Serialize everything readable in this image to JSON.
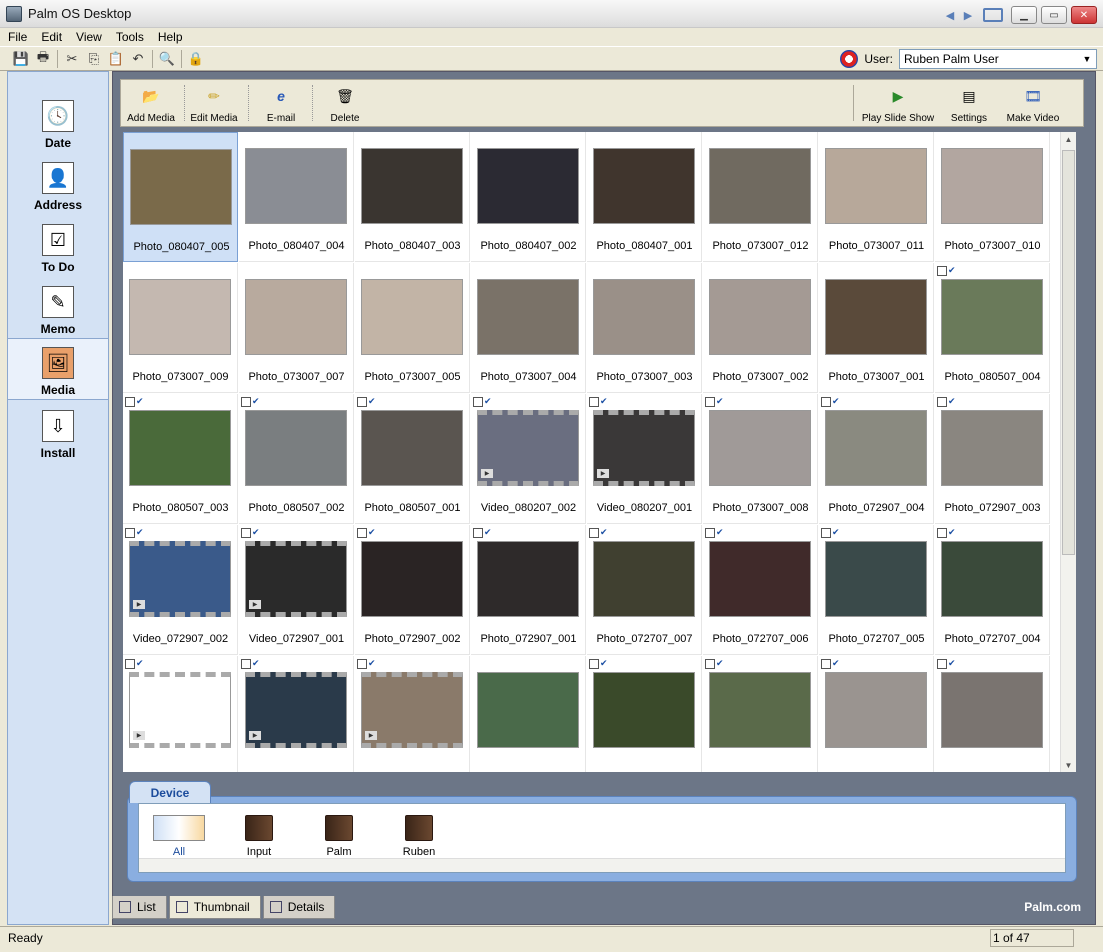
{
  "window": {
    "title": "Palm OS Desktop"
  },
  "menu": [
    "File",
    "Edit",
    "View",
    "Tools",
    "Help"
  ],
  "user": {
    "label": "User:",
    "value": "Ruben Palm User"
  },
  "sidebar": {
    "items": [
      {
        "label": "Date",
        "icon": "clock-calendar-icon"
      },
      {
        "label": "Address",
        "icon": "address-card-icon"
      },
      {
        "label": "To Do",
        "icon": "checklist-icon"
      },
      {
        "label": "Memo",
        "icon": "notepad-icon"
      },
      {
        "label": "Media",
        "icon": "picture-frame-icon"
      },
      {
        "label": "Install",
        "icon": "install-icon"
      }
    ]
  },
  "media_toolbar": {
    "add_media": "Add Media",
    "edit_media": "Edit Media",
    "email": "E-mail",
    "delete": "Delete",
    "play_slide_show": "Play Slide Show",
    "settings": "Settings",
    "make_video": "Make Video"
  },
  "thumbnails": [
    {
      "name": "Photo_080407_005",
      "type": "photo",
      "synced": false,
      "selected": true
    },
    {
      "name": "Photo_080407_004",
      "type": "photo",
      "synced": false
    },
    {
      "name": "Photo_080407_003",
      "type": "photo",
      "synced": false
    },
    {
      "name": "Photo_080407_002",
      "type": "photo",
      "synced": false
    },
    {
      "name": "Photo_080407_001",
      "type": "photo",
      "synced": false
    },
    {
      "name": "Photo_073007_012",
      "type": "photo",
      "synced": false
    },
    {
      "name": "Photo_073007_011",
      "type": "photo",
      "synced": false
    },
    {
      "name": "Photo_073007_010",
      "type": "photo",
      "synced": false
    },
    {
      "name": "Photo_073007_009",
      "type": "photo",
      "synced": false
    },
    {
      "name": "Photo_073007_007",
      "type": "photo",
      "synced": false
    },
    {
      "name": "Photo_073007_005",
      "type": "photo",
      "synced": false
    },
    {
      "name": "Photo_073007_004",
      "type": "photo",
      "synced": false
    },
    {
      "name": "Photo_073007_003",
      "type": "photo",
      "synced": false
    },
    {
      "name": "Photo_073007_002",
      "type": "photo",
      "synced": false
    },
    {
      "name": "Photo_073007_001",
      "type": "photo",
      "synced": false
    },
    {
      "name": "Photo_080507_004",
      "type": "photo",
      "synced": true
    },
    {
      "name": "Photo_080507_003",
      "type": "photo",
      "synced": true
    },
    {
      "name": "Photo_080507_002",
      "type": "photo",
      "synced": true
    },
    {
      "name": "Photo_080507_001",
      "type": "photo",
      "synced": true
    },
    {
      "name": "Video_080207_002",
      "type": "video",
      "synced": true
    },
    {
      "name": "Video_080207_001",
      "type": "video",
      "synced": true
    },
    {
      "name": "Photo_073007_008",
      "type": "photo",
      "synced": true
    },
    {
      "name": "Photo_072907_004",
      "type": "photo",
      "synced": true
    },
    {
      "name": "Photo_072907_003",
      "type": "photo",
      "synced": true
    },
    {
      "name": "Video_072907_002",
      "type": "video",
      "synced": true
    },
    {
      "name": "Video_072907_001",
      "type": "video",
      "synced": true
    },
    {
      "name": "Photo_072907_002",
      "type": "photo",
      "synced": true
    },
    {
      "name": "Photo_072907_001",
      "type": "photo",
      "synced": true
    },
    {
      "name": "Photo_072707_007",
      "type": "photo",
      "synced": true
    },
    {
      "name": "Photo_072707_006",
      "type": "photo",
      "synced": true
    },
    {
      "name": "Photo_072707_005",
      "type": "photo",
      "synced": true
    },
    {
      "name": "Photo_072707_004",
      "type": "photo",
      "synced": true
    },
    {
      "name": "",
      "type": "video",
      "synced": true
    },
    {
      "name": "",
      "type": "video",
      "synced": true
    },
    {
      "name": "",
      "type": "video",
      "synced": true
    },
    {
      "name": "",
      "type": "photo",
      "synced": false
    },
    {
      "name": "",
      "type": "photo",
      "synced": true
    },
    {
      "name": "",
      "type": "photo",
      "synced": true
    },
    {
      "name": "",
      "type": "photo",
      "synced": true
    },
    {
      "name": "",
      "type": "photo",
      "synced": true
    }
  ],
  "thumb_colors": [
    "#7a6a4a",
    "#8a8d94",
    "#3a3530",
    "#2b2a33",
    "#40352d",
    "#706a60",
    "#b7a89a",
    "#b2a6a0",
    "#c4b8b0",
    "#b8aa9e",
    "#c2b4a6",
    "#7a7268",
    "#9a9088",
    "#a49a94",
    "#5a4a3a",
    "#6a7a5a",
    "#4a6a3a",
    "#7a7e80",
    "#5a5550",
    "#6a6e80",
    "#3a3838",
    "#a09a98",
    "#8a8a80",
    "#8a8680",
    "#3a5a8a",
    "#2a2a2a",
    "#2a2424",
    "#2e2a2a",
    "#404030",
    "#402a2a",
    "#3a4a4a",
    "#3a4a3a",
    "#ffffff",
    "#2a3a4a",
    "#8a7a6a",
    "#4a6a4a",
    "#3a4a2a",
    "#5a6a4a",
    "#9a9490",
    "#7a7470"
  ],
  "device": {
    "tab_label": "Device",
    "albums": [
      "All",
      "Input",
      "Palm",
      "Ruben"
    ]
  },
  "view_tabs": [
    "List",
    "Thumbnail",
    "Details"
  ],
  "brand": "Palm.com",
  "status": {
    "text": "Ready",
    "page": "1 of 47"
  }
}
